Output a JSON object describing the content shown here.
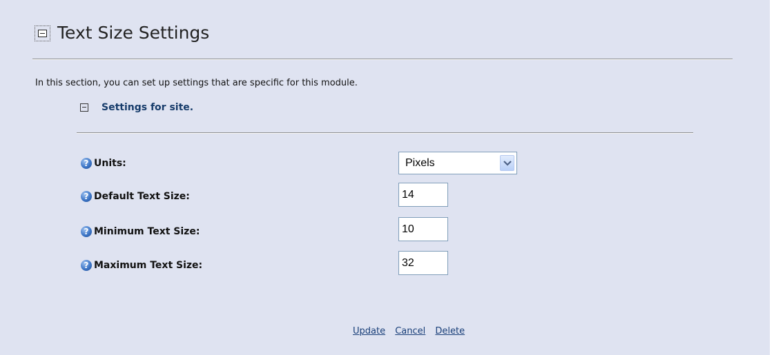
{
  "header": {
    "title": "Text Size Settings",
    "intro": "In this section, you can set up settings that are specific for this module."
  },
  "subsection": {
    "title": "Settings for site."
  },
  "fields": {
    "units": {
      "label": "Units:",
      "value": "Pixels"
    },
    "default_size": {
      "label": "Default Text Size:",
      "value": "14"
    },
    "minimum_size": {
      "label": "Minimum Text Size:",
      "value": "10"
    },
    "maximum_size": {
      "label": "Maximum Text Size:",
      "value": "32"
    }
  },
  "actions": {
    "update": "Update",
    "cancel": "Cancel",
    "delete": "Delete"
  },
  "icons": {
    "help": "?",
    "section_collapse": "minus-box-icon",
    "select_arrow": "chevron-down-icon"
  },
  "colors": {
    "panel_background": "#dfe3f1",
    "subsection_title": "#173c6b",
    "link": "#183e78",
    "input_border": "#7f9db9"
  }
}
